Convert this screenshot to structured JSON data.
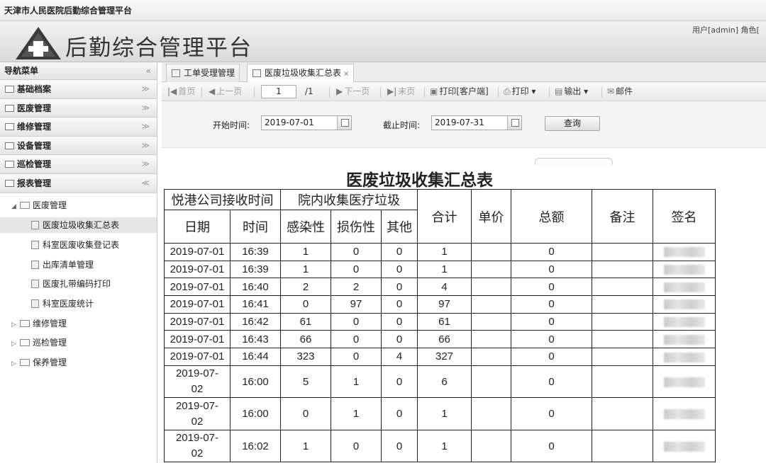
{
  "window_title": "天津市人民医院后勤综合管理平台",
  "banner": {
    "title": "后勤综合管理平台",
    "user_text": "用户[admin]  角色["
  },
  "sidebar": {
    "header": "导航菜单",
    "sections": [
      {
        "label": "基础档案"
      },
      {
        "label": "医废管理"
      },
      {
        "label": "维修管理"
      },
      {
        "label": "设备管理"
      },
      {
        "label": "巡检管理"
      },
      {
        "label": "报表管理"
      }
    ],
    "tree": {
      "group_open": "医废管理",
      "children": [
        "医废垃圾收集汇总表",
        "科室医废收集登记表",
        "出库清单管理",
        "医废扎带编码打印",
        "科室医废统计"
      ],
      "collapsed_groups": [
        "维修管理",
        "巡检管理",
        "保养管理"
      ]
    }
  },
  "tabs": [
    {
      "label": "工单受理管理"
    },
    {
      "label": "医废垃圾收集汇总表",
      "close": "×"
    }
  ],
  "toolbar": {
    "first": "首页",
    "prev": "上一页",
    "page": "1",
    "total": "/1",
    "next": "下一页",
    "last": "末页",
    "print_client": "打印[客户端]",
    "print": "打印 ▾",
    "export": "输出 ▾",
    "mail": "邮件"
  },
  "filters": {
    "start_label": "开始时间:",
    "start_value": "2019-07-01",
    "end_label": "截止时间:",
    "end_value": "2019-07-31",
    "query": "查询"
  },
  "report": {
    "title": "医废垃圾收集汇总表",
    "group1": "悦港公司接收时间",
    "group2": "院内收集医疗垃圾",
    "h_date": "日期",
    "h_time": "时间",
    "h_infect": "感染性",
    "h_damage": "损伤性",
    "h_other": "其他",
    "h_total": "合计",
    "h_price": "单价",
    "h_amount": "总额",
    "h_note": "备注",
    "h_sign": "签名",
    "rows": [
      {
        "date": "2019-07-01",
        "time": "16:39",
        "a": "1",
        "b": "0",
        "c": "0",
        "sum": "1",
        "amount": "0"
      },
      {
        "date": "2019-07-01",
        "time": "16:39",
        "a": "1",
        "b": "0",
        "c": "0",
        "sum": "1",
        "amount": "0"
      },
      {
        "date": "2019-07-01",
        "time": "16:40",
        "a": "2",
        "b": "2",
        "c": "0",
        "sum": "4",
        "amount": "0"
      },
      {
        "date": "2019-07-01",
        "time": "16:41",
        "a": "0",
        "b": "97",
        "c": "0",
        "sum": "97",
        "amount": "0"
      },
      {
        "date": "2019-07-01",
        "time": "16:42",
        "a": "61",
        "b": "0",
        "c": "0",
        "sum": "61",
        "amount": "0"
      },
      {
        "date": "2019-07-01",
        "time": "16:43",
        "a": "66",
        "b": "0",
        "c": "0",
        "sum": "66",
        "amount": "0"
      },
      {
        "date": "2019-07-01",
        "time": "16:44",
        "a": "323",
        "b": "0",
        "c": "4",
        "sum": "327",
        "amount": "0"
      },
      {
        "date": "2019-07-02",
        "time": "16:00",
        "a": "5",
        "b": "1",
        "c": "0",
        "sum": "6",
        "amount": "0"
      },
      {
        "date": "2019-07-02",
        "time": "16:00",
        "a": "0",
        "b": "1",
        "c": "0",
        "sum": "1",
        "amount": "0"
      },
      {
        "date": "2019-07-02",
        "time": "16:02",
        "a": "1",
        "b": "0",
        "c": "0",
        "sum": "1",
        "amount": "0"
      }
    ]
  }
}
